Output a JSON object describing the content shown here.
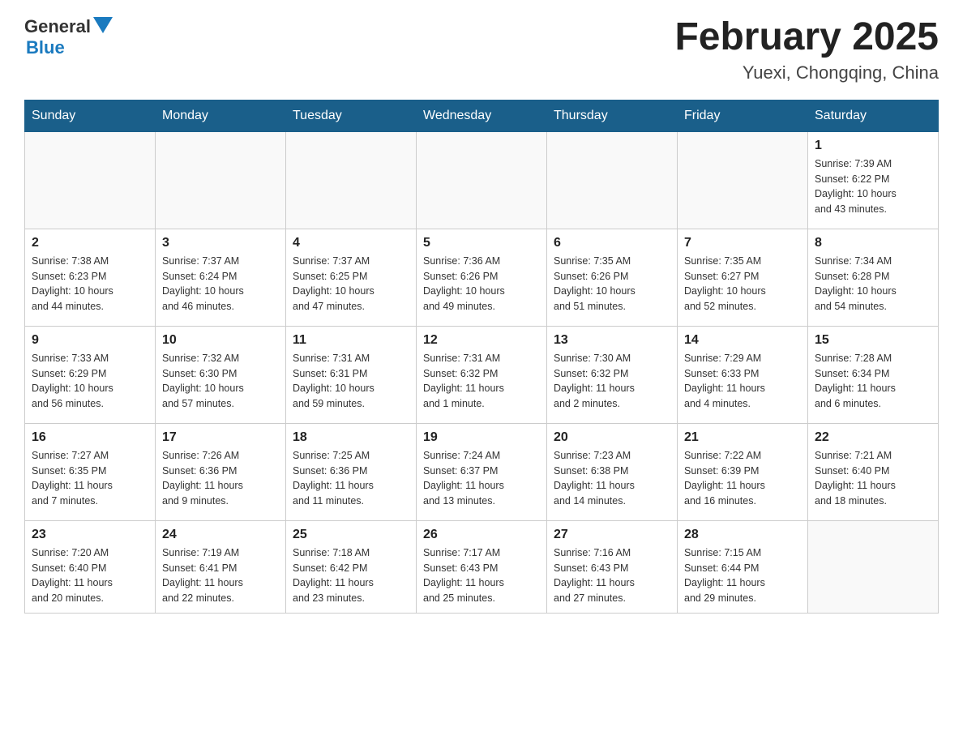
{
  "header": {
    "logo_general": "General",
    "logo_blue": "Blue",
    "month_title": "February 2025",
    "location": "Yuexi, Chongqing, China"
  },
  "weekdays": [
    "Sunday",
    "Monday",
    "Tuesday",
    "Wednesday",
    "Thursday",
    "Friday",
    "Saturday"
  ],
  "weeks": [
    [
      {
        "day": "",
        "info": ""
      },
      {
        "day": "",
        "info": ""
      },
      {
        "day": "",
        "info": ""
      },
      {
        "day": "",
        "info": ""
      },
      {
        "day": "",
        "info": ""
      },
      {
        "day": "",
        "info": ""
      },
      {
        "day": "1",
        "info": "Sunrise: 7:39 AM\nSunset: 6:22 PM\nDaylight: 10 hours\nand 43 minutes."
      }
    ],
    [
      {
        "day": "2",
        "info": "Sunrise: 7:38 AM\nSunset: 6:23 PM\nDaylight: 10 hours\nand 44 minutes."
      },
      {
        "day": "3",
        "info": "Sunrise: 7:37 AM\nSunset: 6:24 PM\nDaylight: 10 hours\nand 46 minutes."
      },
      {
        "day": "4",
        "info": "Sunrise: 7:37 AM\nSunset: 6:25 PM\nDaylight: 10 hours\nand 47 minutes."
      },
      {
        "day": "5",
        "info": "Sunrise: 7:36 AM\nSunset: 6:26 PM\nDaylight: 10 hours\nand 49 minutes."
      },
      {
        "day": "6",
        "info": "Sunrise: 7:35 AM\nSunset: 6:26 PM\nDaylight: 10 hours\nand 51 minutes."
      },
      {
        "day": "7",
        "info": "Sunrise: 7:35 AM\nSunset: 6:27 PM\nDaylight: 10 hours\nand 52 minutes."
      },
      {
        "day": "8",
        "info": "Sunrise: 7:34 AM\nSunset: 6:28 PM\nDaylight: 10 hours\nand 54 minutes."
      }
    ],
    [
      {
        "day": "9",
        "info": "Sunrise: 7:33 AM\nSunset: 6:29 PM\nDaylight: 10 hours\nand 56 minutes."
      },
      {
        "day": "10",
        "info": "Sunrise: 7:32 AM\nSunset: 6:30 PM\nDaylight: 10 hours\nand 57 minutes."
      },
      {
        "day": "11",
        "info": "Sunrise: 7:31 AM\nSunset: 6:31 PM\nDaylight: 10 hours\nand 59 minutes."
      },
      {
        "day": "12",
        "info": "Sunrise: 7:31 AM\nSunset: 6:32 PM\nDaylight: 11 hours\nand 1 minute."
      },
      {
        "day": "13",
        "info": "Sunrise: 7:30 AM\nSunset: 6:32 PM\nDaylight: 11 hours\nand 2 minutes."
      },
      {
        "day": "14",
        "info": "Sunrise: 7:29 AM\nSunset: 6:33 PM\nDaylight: 11 hours\nand 4 minutes."
      },
      {
        "day": "15",
        "info": "Sunrise: 7:28 AM\nSunset: 6:34 PM\nDaylight: 11 hours\nand 6 minutes."
      }
    ],
    [
      {
        "day": "16",
        "info": "Sunrise: 7:27 AM\nSunset: 6:35 PM\nDaylight: 11 hours\nand 7 minutes."
      },
      {
        "day": "17",
        "info": "Sunrise: 7:26 AM\nSunset: 6:36 PM\nDaylight: 11 hours\nand 9 minutes."
      },
      {
        "day": "18",
        "info": "Sunrise: 7:25 AM\nSunset: 6:36 PM\nDaylight: 11 hours\nand 11 minutes."
      },
      {
        "day": "19",
        "info": "Sunrise: 7:24 AM\nSunset: 6:37 PM\nDaylight: 11 hours\nand 13 minutes."
      },
      {
        "day": "20",
        "info": "Sunrise: 7:23 AM\nSunset: 6:38 PM\nDaylight: 11 hours\nand 14 minutes."
      },
      {
        "day": "21",
        "info": "Sunrise: 7:22 AM\nSunset: 6:39 PM\nDaylight: 11 hours\nand 16 minutes."
      },
      {
        "day": "22",
        "info": "Sunrise: 7:21 AM\nSunset: 6:40 PM\nDaylight: 11 hours\nand 18 minutes."
      }
    ],
    [
      {
        "day": "23",
        "info": "Sunrise: 7:20 AM\nSunset: 6:40 PM\nDaylight: 11 hours\nand 20 minutes."
      },
      {
        "day": "24",
        "info": "Sunrise: 7:19 AM\nSunset: 6:41 PM\nDaylight: 11 hours\nand 22 minutes."
      },
      {
        "day": "25",
        "info": "Sunrise: 7:18 AM\nSunset: 6:42 PM\nDaylight: 11 hours\nand 23 minutes."
      },
      {
        "day": "26",
        "info": "Sunrise: 7:17 AM\nSunset: 6:43 PM\nDaylight: 11 hours\nand 25 minutes."
      },
      {
        "day": "27",
        "info": "Sunrise: 7:16 AM\nSunset: 6:43 PM\nDaylight: 11 hours\nand 27 minutes."
      },
      {
        "day": "28",
        "info": "Sunrise: 7:15 AM\nSunset: 6:44 PM\nDaylight: 11 hours\nand 29 minutes."
      },
      {
        "day": "",
        "info": ""
      }
    ]
  ]
}
